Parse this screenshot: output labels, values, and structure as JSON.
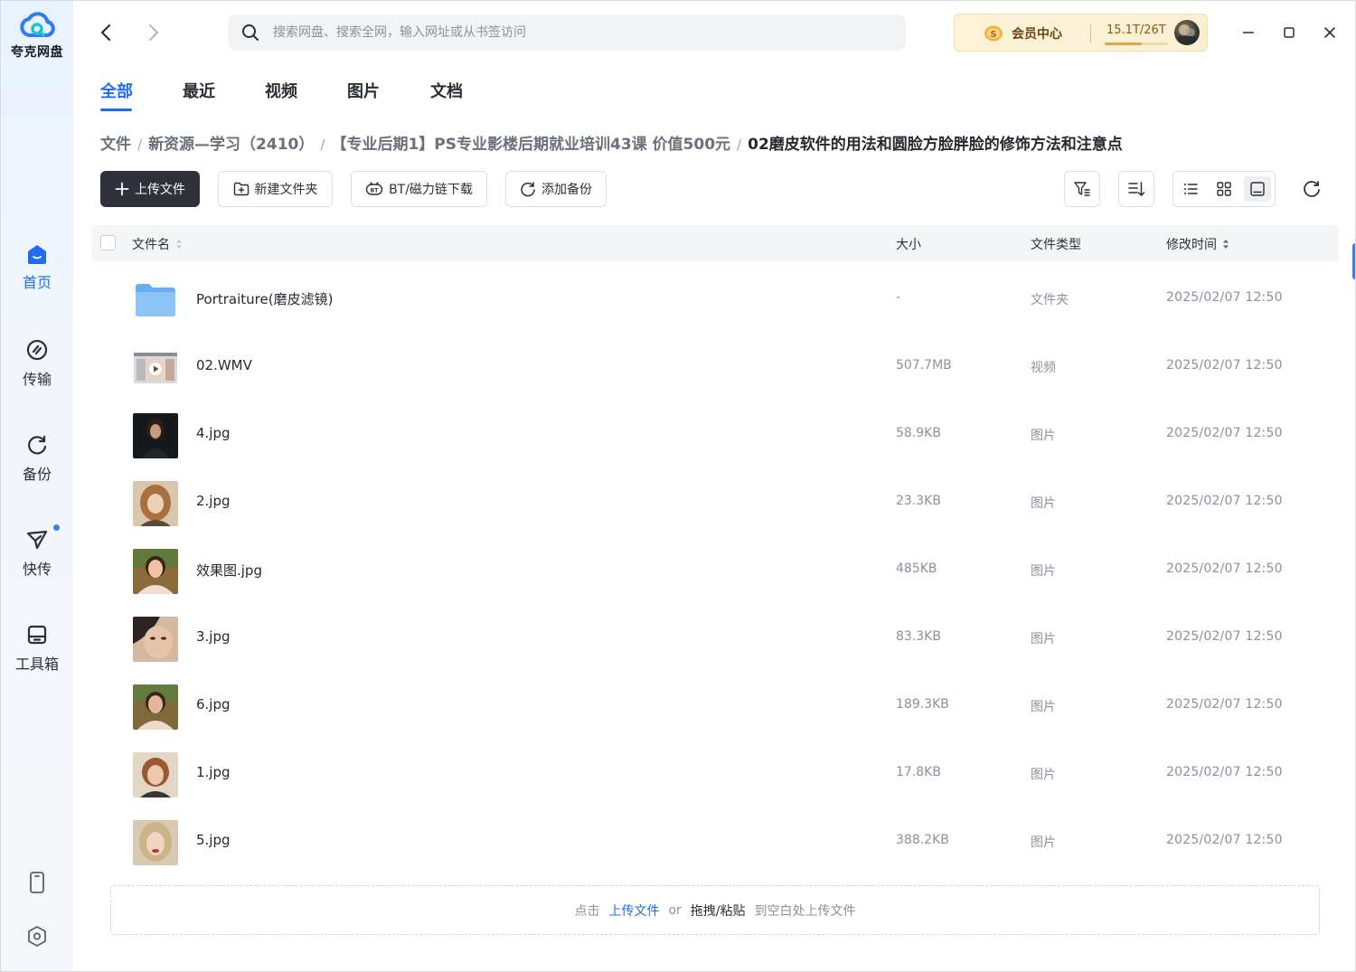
{
  "app": {
    "name": "夸克网盘"
  },
  "sidebar": {
    "items": [
      {
        "label": "首页",
        "icon": "home-icon",
        "active": true
      },
      {
        "label": "传输",
        "icon": "transfer-icon"
      },
      {
        "label": "备份",
        "icon": "backup-icon"
      },
      {
        "label": "快传",
        "icon": "quick-send-icon",
        "dot": true
      },
      {
        "label": "工具箱",
        "icon": "toolbox-icon"
      }
    ],
    "bottom_icons": [
      "phone-icon",
      "settings-icon"
    ]
  },
  "search": {
    "placeholder": "搜索网盘、搜索全网，输入网址或从书签访问"
  },
  "member": {
    "label": "会员中心",
    "storage": "15.1T/26T",
    "storage_ratio": 0.58
  },
  "tabs": [
    "全部",
    "最近",
    "视频",
    "图片",
    "文档"
  ],
  "breadcrumb": [
    "文件",
    "新资源—学习（2410）",
    "【专业后期1】PS专业影楼后期就业培训43课 价值500元",
    "02磨皮软件的用法和圆脸方脸胖脸的修饰方法和注意点"
  ],
  "toolbar": {
    "upload": "上传文件",
    "new_folder": "新建文件夹",
    "bt_download": "BT/磁力链下载",
    "add_backup": "添加备份"
  },
  "table": {
    "headers": {
      "name": "文件名",
      "size": "大小",
      "type": "文件类型",
      "modified": "修改时间"
    },
    "rows": [
      {
        "name": "Portraiture(磨皮滤镜)",
        "size": "-",
        "type": "文件夹",
        "modified": "2025/02/07 12:50",
        "kind": "folder"
      },
      {
        "name": "02.WMV",
        "size": "507.7MB",
        "type": "视频",
        "modified": "2025/02/07 12:50",
        "kind": "video"
      },
      {
        "name": "4.jpg",
        "size": "58.9KB",
        "type": "图片",
        "modified": "2025/02/07 12:50",
        "kind": "image"
      },
      {
        "name": "2.jpg",
        "size": "23.3KB",
        "type": "图片",
        "modified": "2025/02/07 12:50",
        "kind": "image"
      },
      {
        "name": "效果图.jpg",
        "size": "485KB",
        "type": "图片",
        "modified": "2025/02/07 12:50",
        "kind": "image"
      },
      {
        "name": "3.jpg",
        "size": "83.3KB",
        "type": "图片",
        "modified": "2025/02/07 12:50",
        "kind": "image"
      },
      {
        "name": "6.jpg",
        "size": "189.3KB",
        "type": "图片",
        "modified": "2025/02/07 12:50",
        "kind": "image"
      },
      {
        "name": "1.jpg",
        "size": "17.8KB",
        "type": "图片",
        "modified": "2025/02/07 12:50",
        "kind": "image"
      },
      {
        "name": "5.jpg",
        "size": "388.2KB",
        "type": "图片",
        "modified": "2025/02/07 12:50",
        "kind": "image"
      }
    ]
  },
  "dropzone": {
    "prefix": "点击",
    "link": "上传文件",
    "or": "or",
    "drag": "拖拽/粘贴",
    "suffix": "到空白处上传文件"
  },
  "colors": {
    "accent": "#1f6cf3",
    "primary_button": "#2f323a",
    "member_bg": "#fdf3d9"
  }
}
